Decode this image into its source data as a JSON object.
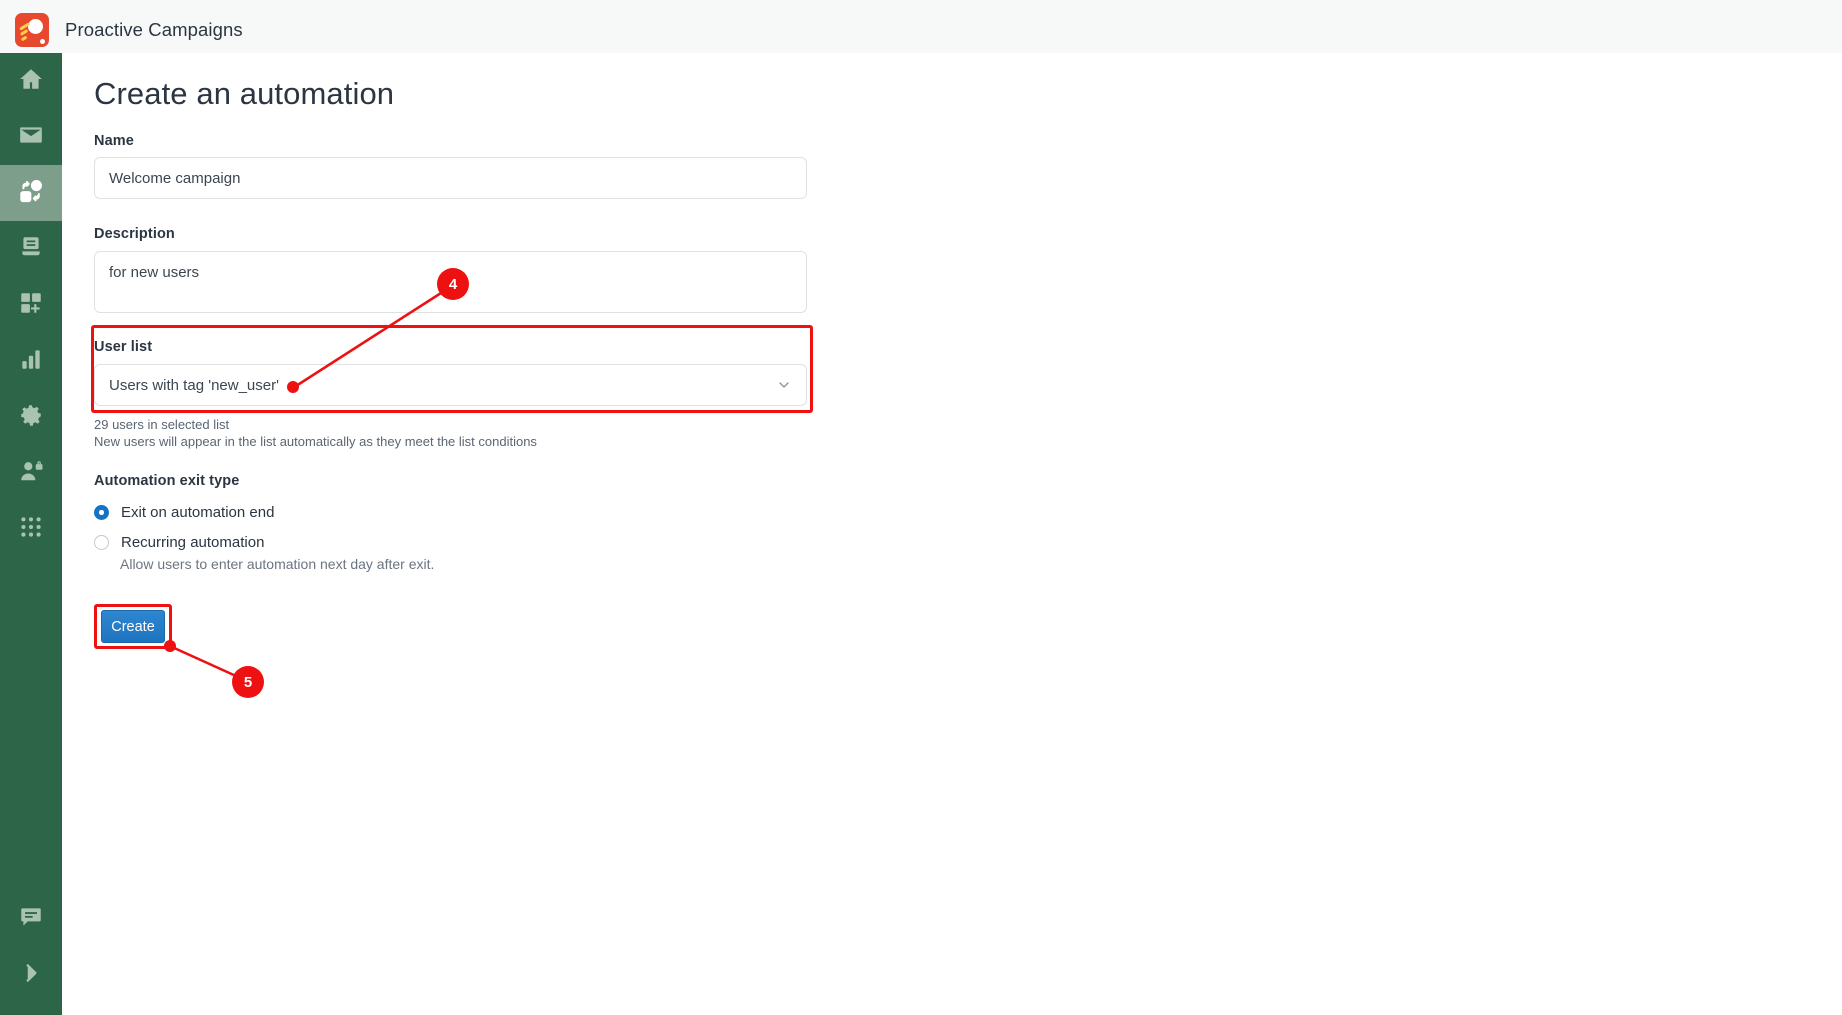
{
  "app": {
    "title": "Proactive Campaigns",
    "logo_icon": "proactive-campaigns-logo",
    "brand_color": "#e8482e",
    "sidebar_color": "#2d6549",
    "accent_color": "#1573c6",
    "annotation_color": "#ee1111"
  },
  "sidebar": {
    "items": [
      {
        "icon": "home-icon",
        "name": "home",
        "active": false
      },
      {
        "icon": "mail-icon",
        "name": "campaigns",
        "active": false
      },
      {
        "icon": "automation-icon",
        "name": "automations",
        "active": true
      },
      {
        "icon": "database-icon",
        "name": "data",
        "active": false
      },
      {
        "icon": "grid-plus-icon",
        "name": "apps",
        "active": false
      },
      {
        "icon": "bar-chart-icon",
        "name": "analytics",
        "active": false
      },
      {
        "icon": "gear-icon",
        "name": "settings",
        "active": false
      },
      {
        "icon": "user-lock-icon",
        "name": "permissions",
        "active": false
      },
      {
        "icon": "apps-grid-icon",
        "name": "all-apps",
        "active": false
      }
    ],
    "bottom_items": [
      {
        "icon": "chat-bubble-icon",
        "name": "chat"
      },
      {
        "icon": "chevron-right-icon",
        "name": "expand"
      }
    ]
  },
  "page": {
    "title": "Create an automation"
  },
  "form": {
    "name": {
      "label": "Name",
      "value": "Welcome campaign",
      "placeholder": "Name"
    },
    "description": {
      "label": "Description",
      "value": "for new users",
      "placeholder": "Description"
    },
    "user_list": {
      "label": "User list",
      "selected": "Users with tag 'new_user'",
      "chevron_icon": "chevron-down-icon",
      "helper_count": "29 users in selected list",
      "helper_note": "New users will appear in the list automatically as they meet the list conditions"
    },
    "exit_type": {
      "label": "Automation exit type",
      "options": [
        {
          "label": "Exit on automation end",
          "selected": true,
          "sub": ""
        },
        {
          "label": "Recurring automation",
          "selected": false,
          "sub": "Allow users to enter automation next day after exit."
        }
      ],
      "recurring_sub": "Allow users to enter automation next day after exit."
    },
    "submit": {
      "label": "Create"
    }
  },
  "annotations": [
    {
      "id": "4",
      "target": "user-list-dropdown"
    },
    {
      "id": "5",
      "target": "create-button"
    }
  ]
}
